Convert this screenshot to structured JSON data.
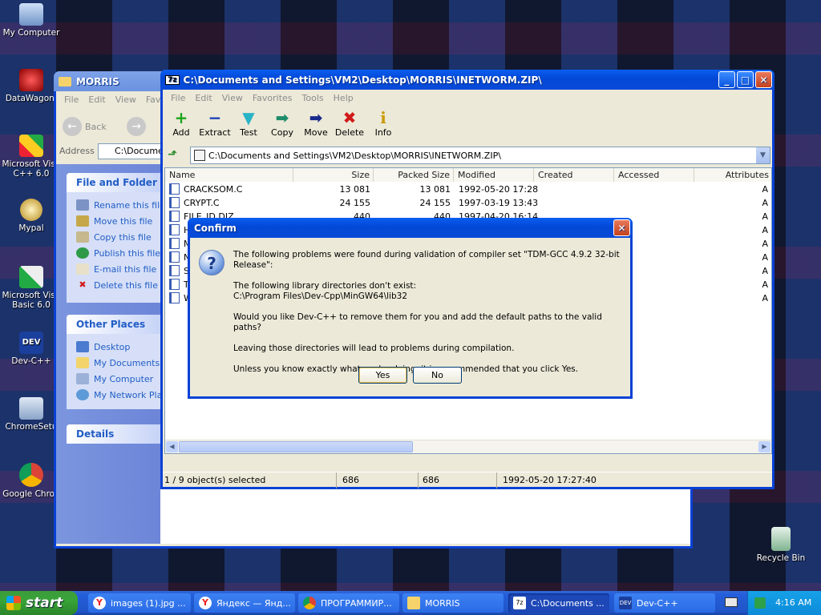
{
  "desktop_icons": [
    {
      "label": "My Computer"
    },
    {
      "label": "DataWagon."
    },
    {
      "label": "Microsoft Visu C++ 6.0"
    },
    {
      "label": "Mypal"
    },
    {
      "label": "Microsoft Visu Basic 6.0"
    },
    {
      "label": "Dev-C++"
    },
    {
      "label": "ChromeSetu"
    },
    {
      "label": "Google Chron"
    },
    {
      "label": "Recycle Bin"
    }
  ],
  "explorer": {
    "title": "MORRIS",
    "menu": [
      "File",
      "Edit",
      "View",
      "Fav"
    ],
    "back_label": "Back",
    "address_label": "Address",
    "address_value": "C:\\Documen",
    "tasks_title": "File and Folder Tas",
    "tasks": [
      "Rename this file",
      "Move this file",
      "Copy this file",
      "Publish this file to",
      "E-mail this file",
      "Delete this file"
    ],
    "places_title": "Other Places",
    "places": [
      "Desktop",
      "My Documents",
      "My Computer",
      "My Network Plac"
    ],
    "details_title": "Details"
  },
  "zip": {
    "title": "C:\\Documents and Settings\\VM2\\Desktop\\MORRIS\\INETWORM.ZIP\\",
    "app_icon": "7z",
    "menu": [
      "File",
      "Edit",
      "View",
      "Favorites",
      "Tools",
      "Help"
    ],
    "toolbar": [
      {
        "label": "Add",
        "icon": "+",
        "color": "#1aa51a"
      },
      {
        "label": "Extract",
        "icon": "−",
        "color": "#1b3fb8"
      },
      {
        "label": "Test",
        "icon": "▼",
        "color": "#29b3c7"
      },
      {
        "label": "Copy",
        "icon": "➡",
        "color": "#1c8c6a"
      },
      {
        "label": "Move",
        "icon": "➡",
        "color": "#1a2a8c"
      },
      {
        "label": "Delete",
        "icon": "✖",
        "color": "#d11a1a"
      },
      {
        "label": "Info",
        "icon": "i",
        "color": "#c99a00"
      }
    ],
    "path": "C:\\Documents and Settings\\VM2\\Desktop\\MORRIS\\INETWORM.ZIP\\",
    "columns": [
      "Name",
      "Size",
      "Packed Size",
      "Modified",
      "Created",
      "Accessed",
      "Attributes"
    ],
    "rows": [
      {
        "name": "CRACKSOM.C",
        "size": "13 081",
        "packed": "13 081",
        "modified": "1992-05-20 17:28",
        "attr": "A"
      },
      {
        "name": "CRYPT.C",
        "size": "24 155",
        "packed": "24 155",
        "modified": "1997-03-19 13:43",
        "attr": "A"
      },
      {
        "name": "FILE_ID.DIZ",
        "size": "440",
        "packed": "440",
        "modified": "1997-04-20 16:14",
        "attr": "A"
      },
      {
        "name": "H",
        "size": "",
        "packed": "",
        "modified": "",
        "attr": "A"
      },
      {
        "name": "M",
        "size": "",
        "packed": "",
        "modified": "",
        "attr": "A"
      },
      {
        "name": "N",
        "size": "",
        "packed": "",
        "modified": "",
        "attr": "A"
      },
      {
        "name": "ST",
        "size": "",
        "packed": "",
        "modified": "",
        "attr": "A"
      },
      {
        "name": "TI",
        "size": "",
        "packed": "",
        "modified": "",
        "attr": "A"
      },
      {
        "name": "W",
        "size": "",
        "packed": "",
        "modified": "",
        "attr": "A"
      }
    ],
    "status": {
      "selection": "1 / 9 object(s) selected",
      "size": "686",
      "packed": "686",
      "modified": "1992-05-20 17:27:40"
    }
  },
  "dialog": {
    "title": "Confirm",
    "line1": "The following problems were found during validation of compiler set \"TDM-GCC 4.9.2 32-bit Release\":",
    "line2a": "The following library directories don't exist:",
    "line2b": "C:\\Program Files\\Dev-Cpp\\MinGW64\\lib32",
    "line3": "Would you like Dev-C++ to remove them for you and add the default paths to the valid paths?",
    "line4": "Leaving those directories will lead to problems during compilation.",
    "line5": "Unless you know exactly what you're doing, it is recommended that you click Yes.",
    "yes": "Yes",
    "no": "No",
    "icon": "?"
  },
  "taskbar": {
    "start": "start",
    "tasks": [
      "images (1).jpg ...",
      "Яндекс — Янд...",
      "ПРОГРАММИР...",
      "MORRIS",
      "C:\\Documents ...",
      "Dev-C++"
    ],
    "clock": "4:16 AM"
  }
}
